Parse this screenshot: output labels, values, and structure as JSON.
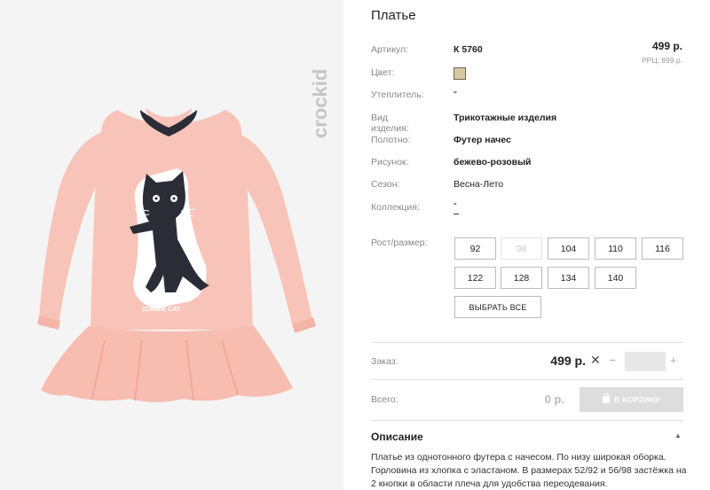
{
  "product": {
    "title": "Платье",
    "price": "499 р.",
    "rrp": "РРЦ: 899 р.",
    "swatch_color": "#d8c9a2",
    "brand_logo": "crockid"
  },
  "attributes": [
    {
      "label": "Артикул:",
      "value": "К 5760"
    },
    {
      "label": "Цвет:",
      "value": ""
    },
    {
      "label": "Утеплитель:",
      "value": "\""
    },
    {
      "label": "Вид изделия:",
      "value": "Трикотажные изделия"
    },
    {
      "label": "Полотно:",
      "value": "Футер начес"
    },
    {
      "label": "Рисунок:",
      "value": "бежево-розовый"
    },
    {
      "label": "Сезон:",
      "value": "Весна-Лето"
    },
    {
      "label": "Коллекция:",
      "value": "\""
    }
  ],
  "sizes": {
    "label": "Рост/размер:",
    "items": [
      {
        "label": "92",
        "available": true
      },
      {
        "label": "98",
        "available": false
      },
      {
        "label": "104",
        "available": true
      },
      {
        "label": "110",
        "available": true
      },
      {
        "label": "116",
        "available": true
      },
      {
        "label": "122",
        "available": true
      },
      {
        "label": "128",
        "available": true
      },
      {
        "label": "134",
        "available": true
      },
      {
        "label": "140",
        "available": true
      }
    ],
    "select_all": "ВЫБРАТЬ ВСЕ"
  },
  "order": {
    "label": "Заказ:",
    "price": "499 р.",
    "times": "✕",
    "minus": "−",
    "plus": "+",
    "quantity": ""
  },
  "total": {
    "label": "Всего:",
    "value": "0 р.",
    "cart_button": "В КОРЗИНУ"
  },
  "description": {
    "title": "Описание",
    "caret": "▲",
    "text": "Платье из однотонного футера с начесом. По низу широкая оборка. Горловина из хлопка с эластаном. В размерах 52/92 и 56/98 застёжка на 2 кнопки в области плеча для удобства переодевания."
  }
}
